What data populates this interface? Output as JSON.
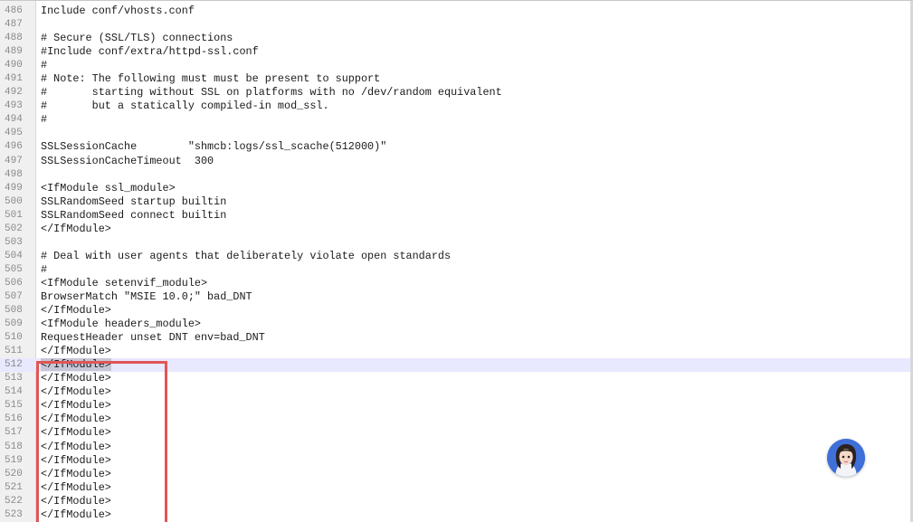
{
  "editor": {
    "current_line": "512",
    "selected_text": "</IfModule>",
    "lines": [
      {
        "n": "486",
        "text": "Include conf/vhosts.conf"
      },
      {
        "n": "487",
        "text": ""
      },
      {
        "n": "488",
        "text": "# Secure (SSL/TLS) connections"
      },
      {
        "n": "489",
        "text": "#Include conf/extra/httpd-ssl.conf"
      },
      {
        "n": "490",
        "text": "#"
      },
      {
        "n": "491",
        "text": "# Note: The following must must be present to support"
      },
      {
        "n": "492",
        "text": "#       starting without SSL on platforms with no /dev/random equivalent"
      },
      {
        "n": "493",
        "text": "#       but a statically compiled-in mod_ssl."
      },
      {
        "n": "494",
        "text": "#"
      },
      {
        "n": "495",
        "text": ""
      },
      {
        "n": "496",
        "text": "SSLSessionCache        \"shmcb:logs/ssl_scache(512000)\""
      },
      {
        "n": "497",
        "text": "SSLSessionCacheTimeout  300"
      },
      {
        "n": "498",
        "text": ""
      },
      {
        "n": "499",
        "text": "<IfModule ssl_module>"
      },
      {
        "n": "500",
        "text": "SSLRandomSeed startup builtin"
      },
      {
        "n": "501",
        "text": "SSLRandomSeed connect builtin"
      },
      {
        "n": "502",
        "text": "</IfModule>"
      },
      {
        "n": "503",
        "text": ""
      },
      {
        "n": "504",
        "text": "# Deal with user agents that deliberately violate open standards"
      },
      {
        "n": "505",
        "text": "#"
      },
      {
        "n": "506",
        "text": "<IfModule setenvif_module>"
      },
      {
        "n": "507",
        "text": "BrowserMatch \"MSIE 10.0;\" bad_DNT"
      },
      {
        "n": "508",
        "text": "</IfModule>"
      },
      {
        "n": "509",
        "text": "<IfModule headers_module>"
      },
      {
        "n": "510",
        "text": "RequestHeader unset DNT env=bad_DNT"
      },
      {
        "n": "511",
        "text": "</IfModule>"
      },
      {
        "n": "512",
        "text": "</IfModule>"
      },
      {
        "n": "513",
        "text": "</IfModule>"
      },
      {
        "n": "514",
        "text": "</IfModule>"
      },
      {
        "n": "515",
        "text": "</IfModule>"
      },
      {
        "n": "516",
        "text": "</IfModule>"
      },
      {
        "n": "517",
        "text": "</IfModule>"
      },
      {
        "n": "518",
        "text": "</IfModule>"
      },
      {
        "n": "519",
        "text": "</IfModule>"
      },
      {
        "n": "520",
        "text": "</IfModule>"
      },
      {
        "n": "521",
        "text": "</IfModule>"
      },
      {
        "n": "522",
        "text": "</IfModule>"
      },
      {
        "n": "523",
        "text": "</IfModule>"
      }
    ]
  },
  "annotation": {
    "highlight_color": "#e05656",
    "icon": "highlight-box"
  },
  "assistant": {
    "icon": "assistant-avatar-icon",
    "color": "#3f6fd8"
  }
}
